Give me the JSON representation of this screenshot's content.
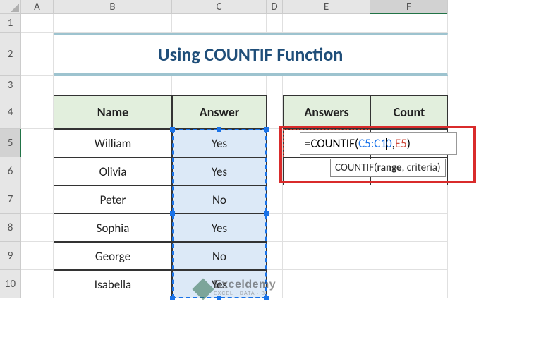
{
  "columns": [
    "A",
    "B",
    "C",
    "D",
    "E",
    "F"
  ],
  "rows": [
    "1",
    "2",
    "3",
    "4",
    "5",
    "6",
    "7",
    "8",
    "9",
    "10"
  ],
  "title": "Using COUNTIF Function",
  "table1": {
    "headers": [
      "Name",
      "Answer"
    ],
    "rows": [
      [
        "William",
        "Yes"
      ],
      [
        "Olivia",
        "Yes"
      ],
      [
        "Peter",
        "No"
      ],
      [
        "Sophia",
        "Yes"
      ],
      [
        "George",
        "No"
      ],
      [
        "Isabella",
        "Yes"
      ]
    ]
  },
  "table2": {
    "headers": [
      "Answers",
      "Count"
    ]
  },
  "formula": {
    "prefix": "=COUNTIF(",
    "ref1": "C5:C1",
    "ref1_tail": "0",
    "comma": ",",
    "ref2": "E5",
    "suffix": ")"
  },
  "tooltip": {
    "fn": "COUNTIF(",
    "arg1": "range",
    "mid": ", criteria)"
  },
  "watermark": {
    "line1": "Exceldemy",
    "line2": "EXCEL · DATA · BI"
  },
  "selected_col": "F",
  "selected_row": "5",
  "chart_data": {
    "type": "table",
    "title": "Using COUNTIF Function",
    "columns": [
      "Name",
      "Answer"
    ],
    "rows": [
      [
        "William",
        "Yes"
      ],
      [
        "Olivia",
        "Yes"
      ],
      [
        "Peter",
        "No"
      ],
      [
        "Sophia",
        "Yes"
      ],
      [
        "George",
        "No"
      ],
      [
        "Isabella",
        "Yes"
      ]
    ],
    "formula_cell": "F5",
    "formula": "=COUNTIF(C5:C10,E5)"
  }
}
